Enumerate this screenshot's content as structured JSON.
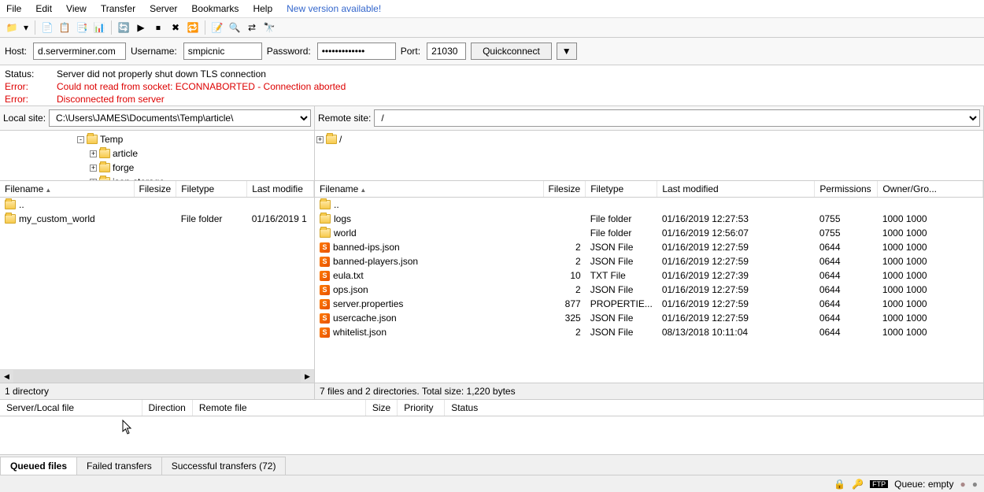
{
  "menu": [
    "File",
    "Edit",
    "View",
    "Transfer",
    "Server",
    "Bookmarks",
    "Help"
  ],
  "new_version": "New version available!",
  "quickbar": {
    "host_label": "Host:",
    "host": "d.serverminer.com",
    "user_label": "Username:",
    "user": "smpicnic",
    "pass_label": "Password:",
    "pass": "•••••••••••••",
    "port_label": "Port:",
    "port": "21030",
    "connect": "Quickconnect"
  },
  "log": [
    {
      "label": "Status:",
      "text": "Server did not properly shut down TLS connection",
      "error": false
    },
    {
      "label": "Error:",
      "text": "Could not read from socket: ECONNABORTED - Connection aborted",
      "error": true
    },
    {
      "label": "Error:",
      "text": "Disconnected from server",
      "error": true
    }
  ],
  "local": {
    "path_label": "Local site:",
    "path": "C:\\Users\\JAMES\\Documents\\Temp\\article\\",
    "tree": [
      {
        "indent": 6,
        "expand": "-",
        "name": "Temp"
      },
      {
        "indent": 7,
        "expand": "+",
        "name": "article"
      },
      {
        "indent": 7,
        "expand": "+",
        "name": "forge"
      },
      {
        "indent": 7,
        "expand": "+",
        "name": "json-storage"
      }
    ],
    "columns": [
      "Filename",
      "Filesize",
      "Filetype",
      "Last modifie"
    ],
    "rows": [
      {
        "name": "..",
        "size": "",
        "type": "",
        "mod": "",
        "icon": "folder"
      },
      {
        "name": "my_custom_world",
        "size": "",
        "type": "File folder",
        "mod": "01/16/2019 1",
        "icon": "folder"
      }
    ],
    "status": "1 directory"
  },
  "remote": {
    "path_label": "Remote site:",
    "path": "/",
    "tree": [
      {
        "indent": 0,
        "expand": "+",
        "name": "/"
      }
    ],
    "columns": [
      "Filename",
      "Filesize",
      "Filetype",
      "Last modified",
      "Permissions",
      "Owner/Gro..."
    ],
    "rows": [
      {
        "name": "..",
        "size": "",
        "type": "",
        "mod": "",
        "perm": "",
        "owner": "",
        "icon": "folder"
      },
      {
        "name": "logs",
        "size": "",
        "type": "File folder",
        "mod": "01/16/2019 12:27:53",
        "perm": "0755",
        "owner": "1000 1000",
        "icon": "folder"
      },
      {
        "name": "world",
        "size": "",
        "type": "File folder",
        "mod": "01/16/2019 12:56:07",
        "perm": "0755",
        "owner": "1000 1000",
        "icon": "folder"
      },
      {
        "name": "banned-ips.json",
        "size": "2",
        "type": "JSON File",
        "mod": "01/16/2019 12:27:59",
        "perm": "0644",
        "owner": "1000 1000",
        "icon": "file"
      },
      {
        "name": "banned-players.json",
        "size": "2",
        "type": "JSON File",
        "mod": "01/16/2019 12:27:59",
        "perm": "0644",
        "owner": "1000 1000",
        "icon": "file"
      },
      {
        "name": "eula.txt",
        "size": "10",
        "type": "TXT File",
        "mod": "01/16/2019 12:27:39",
        "perm": "0644",
        "owner": "1000 1000",
        "icon": "file"
      },
      {
        "name": "ops.json",
        "size": "2",
        "type": "JSON File",
        "mod": "01/16/2019 12:27:59",
        "perm": "0644",
        "owner": "1000 1000",
        "icon": "file"
      },
      {
        "name": "server.properties",
        "size": "877",
        "type": "PROPERTIE...",
        "mod": "01/16/2019 12:27:59",
        "perm": "0644",
        "owner": "1000 1000",
        "icon": "file"
      },
      {
        "name": "usercache.json",
        "size": "325",
        "type": "JSON File",
        "mod": "01/16/2019 12:27:59",
        "perm": "0644",
        "owner": "1000 1000",
        "icon": "file"
      },
      {
        "name": "whitelist.json",
        "size": "2",
        "type": "JSON File",
        "mod": "08/13/2018 10:11:04",
        "perm": "0644",
        "owner": "1000 1000",
        "icon": "file"
      }
    ],
    "status": "7 files and 2 directories. Total size: 1,220 bytes"
  },
  "transfer_columns": [
    "Server/Local file",
    "Direction",
    "Remote file",
    "Size",
    "Priority",
    "Status"
  ],
  "queue_tabs": [
    "Queued files",
    "Failed transfers",
    "Successful transfers (72)"
  ],
  "status_queue": "Queue: empty"
}
